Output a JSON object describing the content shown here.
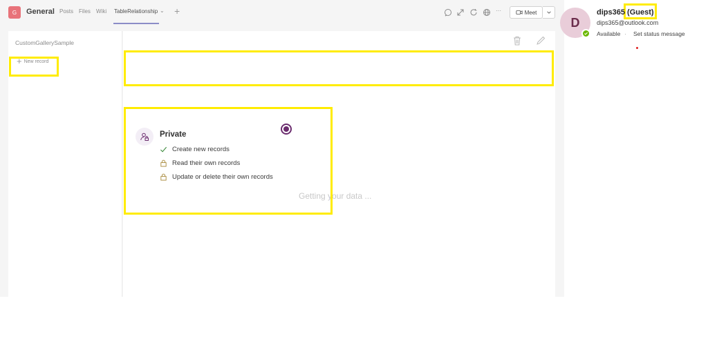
{
  "header": {
    "team_initial": "G",
    "team_name": "General",
    "tabs": [
      {
        "label": "Posts"
      },
      {
        "label": "Files"
      },
      {
        "label": "Wiki"
      },
      {
        "label": "TableRelationship"
      }
    ],
    "tab_caret": "⌄",
    "add_tab": "+",
    "more": "···",
    "meet_label": "Meet"
  },
  "gallery": {
    "title": "CustomGallerySample",
    "new_record_label": "New record"
  },
  "permissions": {
    "title": "Private",
    "rows": [
      {
        "label": "Create new records",
        "icon": "check-icon"
      },
      {
        "label": "Read their own records",
        "icon": "lock-icon"
      },
      {
        "label": "Update or delete their own records",
        "icon": "lock-icon"
      }
    ]
  },
  "main": {
    "loading_text": "Getting your data ..."
  },
  "profile": {
    "initial": "D",
    "name": "dips365",
    "guest_tag": "(Guest)",
    "email": "dips365@outlook.com",
    "status": "Available",
    "separator": "·",
    "set_status": "Set status message"
  },
  "colors": {
    "highlight": "#ffec00",
    "accent": "#6b2c6e",
    "presence": "#6bb700"
  }
}
